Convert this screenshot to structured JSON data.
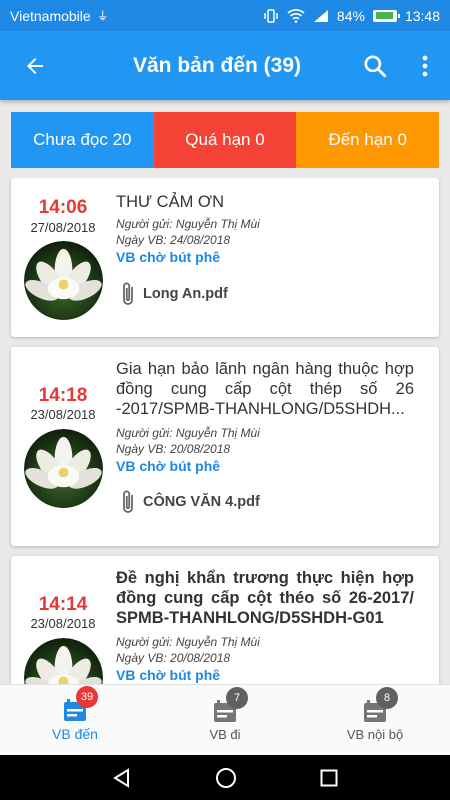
{
  "status_bar": {
    "carrier": "Vietnamobile",
    "battery": "84%",
    "time": "13:48"
  },
  "app_bar": {
    "title": "Văn bản đến (39)"
  },
  "filters": [
    {
      "label": "Chưa đọc 20",
      "color": "#2196f3"
    },
    {
      "label": "Quá hạn 0",
      "color": "#f44336"
    },
    {
      "label": "Đến hạn 0",
      "color": "#ff9800"
    }
  ],
  "documents": [
    {
      "time": "14:06",
      "date": "27/08/2018",
      "title": "THƯ CẢM ƠN",
      "sender": "Người gửi: Nguyễn Thị Mùi",
      "doc_date": "Ngày VB: 24/08/2018",
      "status": "VB chờ bút phê",
      "attachment": "Long An.pdf"
    },
    {
      "time": "14:18",
      "date": "23/08/2018",
      "title": "Gia hạn bảo lãnh ngân hàng thuộc hợp đồng cung cấp cột thép số 26 -2017/SPMB-THANHLONG/D5SHDH...",
      "sender": "Người gửi: Nguyễn Thị Mùi",
      "doc_date": "Ngày VB: 20/08/2018",
      "status": "VB chờ bút phê",
      "attachment": "CÔNG VĂN 4.pdf"
    },
    {
      "time": "14:14",
      "date": "23/08/2018",
      "title": "Đề nghị khẩn trương thực hiện hợp đồng cung cấp cột théo số 26-2017/ SPMB-THANHLONG/D5SHDH-G01",
      "sender": "Người gửi: Nguyễn Thị Mùi",
      "doc_date": "Ngày VB: 20/08/2018",
      "status": "VB chờ bút phê"
    }
  ],
  "bottom_nav": [
    {
      "label": "VB đến",
      "badge": "39",
      "active": true
    },
    {
      "label": "VB đi",
      "badge": "7",
      "active": false
    },
    {
      "label": "VB nội bộ",
      "badge": "8",
      "active": false
    }
  ],
  "colors": {
    "primary": "#2196f3",
    "time_red": "#e53935",
    "status_blue": "#1e88e5"
  },
  "icons": [
    "back-arrow-icon",
    "search-icon",
    "more-vert-icon",
    "paperclip-icon",
    "calendar-icon",
    "lotus-avatar"
  ]
}
